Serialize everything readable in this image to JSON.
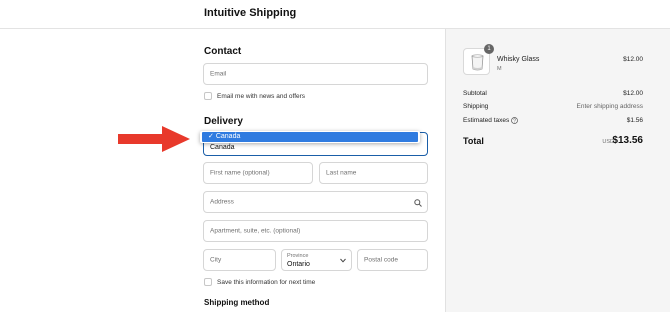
{
  "header": {
    "store_name": "Intuitive Shipping"
  },
  "contact": {
    "heading": "Contact",
    "email_placeholder": "Email",
    "newsletter_label": "Email me with news and offers"
  },
  "delivery": {
    "heading": "Delivery",
    "country_value": "Canada",
    "dropdown_options": [
      {
        "label": "Canada",
        "selected": true
      }
    ],
    "first_name_placeholder": "First name (optional)",
    "last_name_placeholder": "Last name",
    "address_placeholder": "Address",
    "apartment_placeholder": "Apartment, suite, etc. (optional)",
    "city_placeholder": "City",
    "province_label": "Province",
    "province_value": "Ontario",
    "postal_placeholder": "Postal code",
    "save_info_label": "Save this information for next time"
  },
  "shipping_method": {
    "heading": "Shipping method"
  },
  "summary": {
    "item": {
      "name": "Whisky Glass",
      "variant": "M",
      "price": "$12.00",
      "quantity": "1"
    },
    "subtotal_label": "Subtotal",
    "subtotal_value": "$12.00",
    "shipping_label": "Shipping",
    "shipping_value": "Enter shipping address",
    "taxes_label": "Estimated taxes",
    "taxes_value": "$1.56",
    "total_label": "Total",
    "total_currency": "USD",
    "total_value": "$13.56"
  },
  "colors": {
    "accent": "#1a5ea8",
    "highlight": "#2f7be0",
    "arrow": "#e8392b",
    "summary_bg": "#f5f5f5"
  }
}
